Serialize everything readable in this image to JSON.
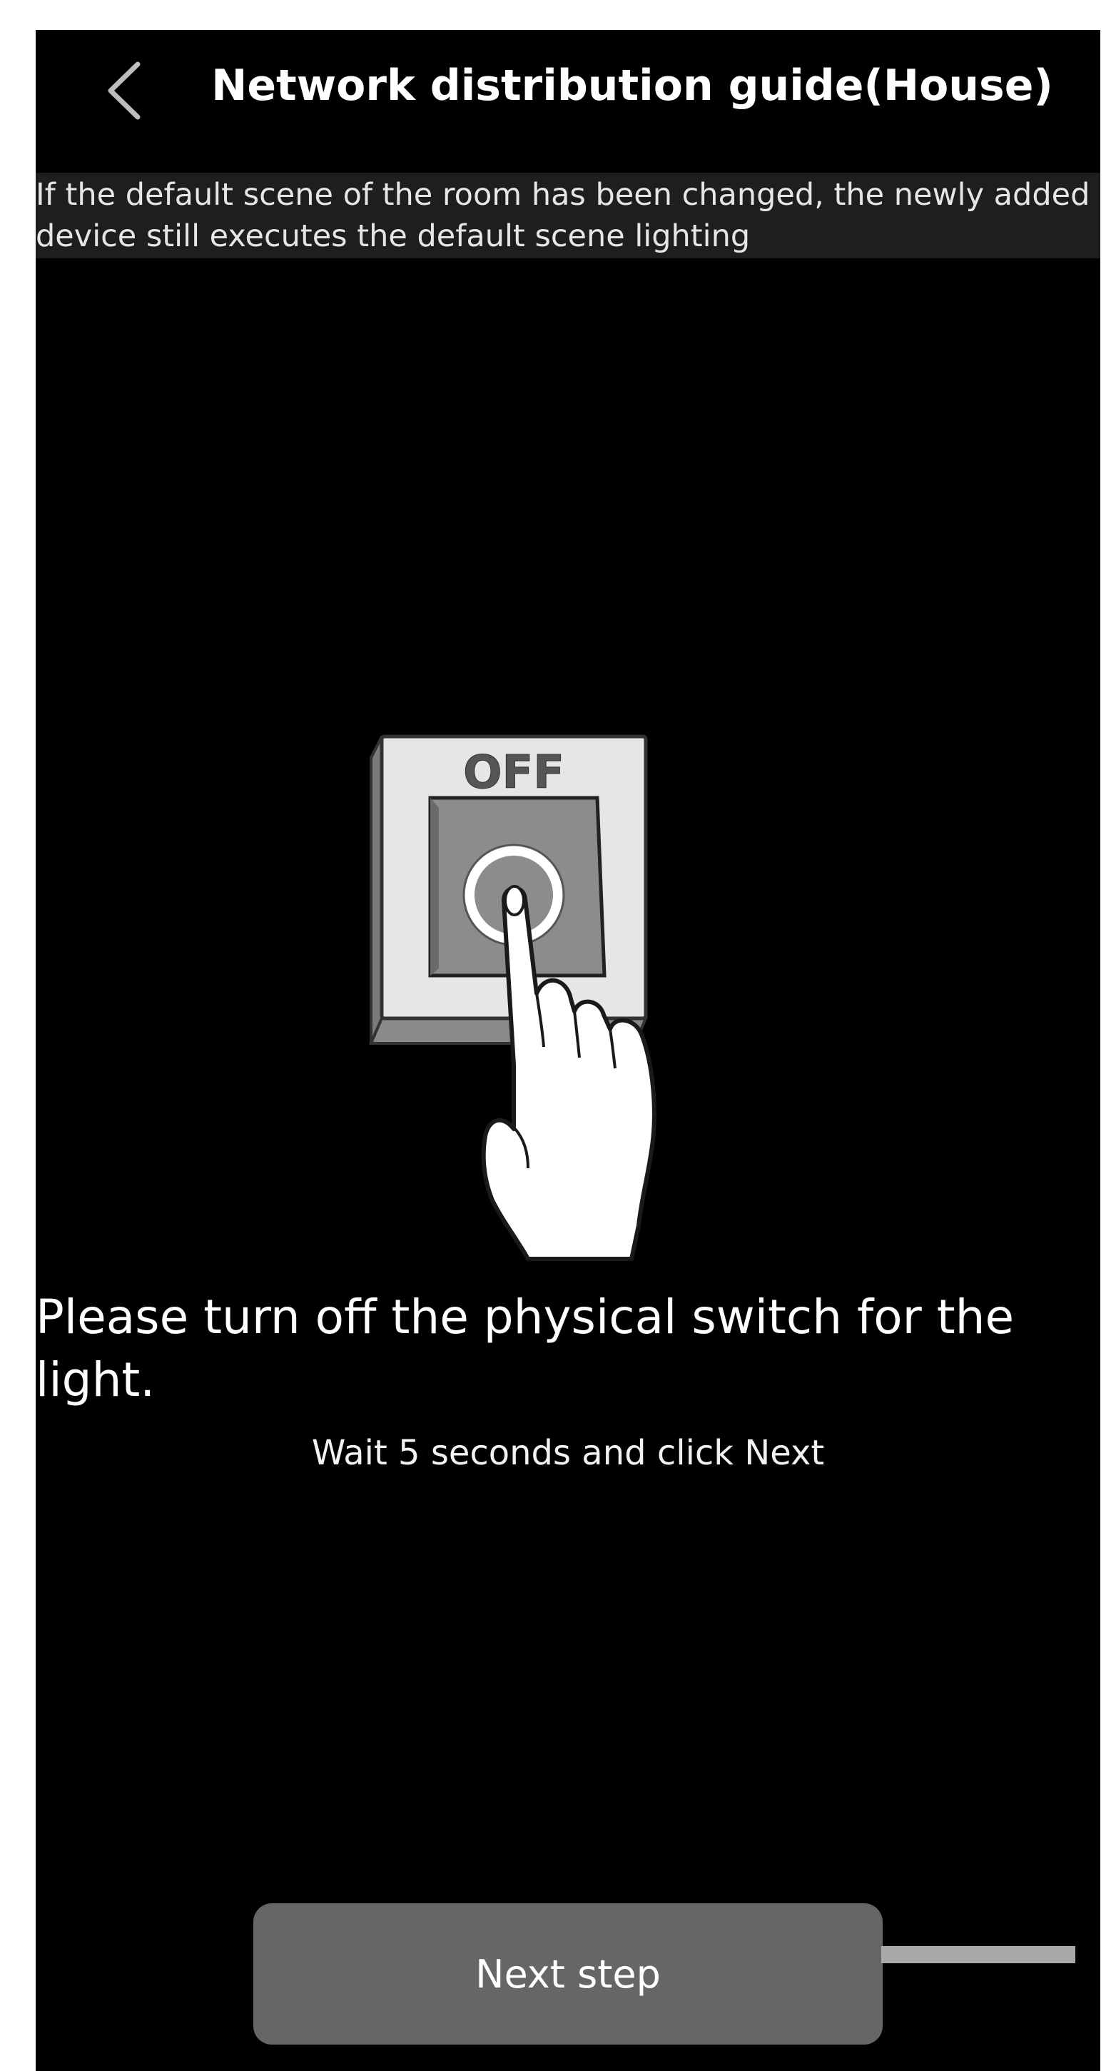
{
  "header": {
    "back_icon": "chevron-left-icon",
    "title": "Network distribution guide(House)"
  },
  "notice": {
    "text": "If the default scene of the room has been changed, the newly added device still executes the default scene lighting"
  },
  "illustration": {
    "switch_label": "OFF",
    "icon": "switch-press-hand-illustration"
  },
  "instruction": {
    "title": "Please turn off the physical switch for the light.",
    "subtitle": "Wait 5 seconds and click Next"
  },
  "footer": {
    "next_label": "Next step"
  },
  "colors": {
    "background": "#000000",
    "notice_bg": "#1e1e1e",
    "button_bg": "#666666",
    "text": "#ffffff"
  }
}
